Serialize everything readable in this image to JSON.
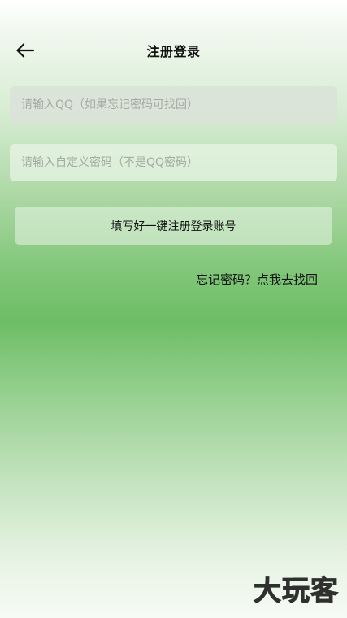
{
  "header": {
    "title": "注册登录",
    "back_icon": "arrow-left-icon"
  },
  "form": {
    "qq_placeholder": "请输入QQ（如果忘记密码可找回）",
    "qq_value": "",
    "password_placeholder": "请输入自定义密码（不是QQ密码）",
    "password_value": "",
    "submit_label": "填写好一键注册登录账号",
    "forgot_link": "忘记密码？点我去找回"
  },
  "watermark": {
    "text": "大玩客"
  },
  "colors": {
    "accent_green": "#6dbd66",
    "text": "#111111",
    "placeholder": "#a4aba3"
  }
}
